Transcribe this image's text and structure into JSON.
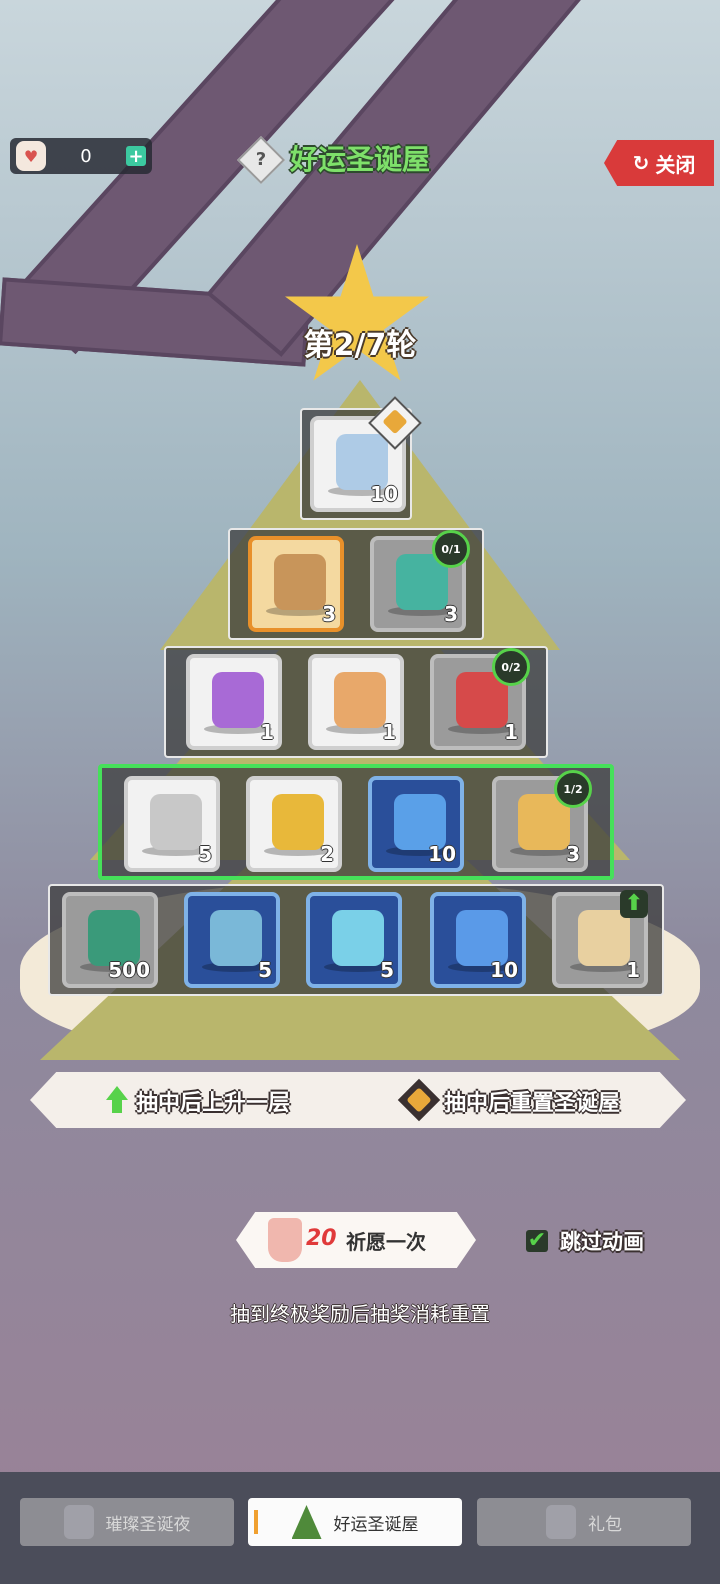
{
  "header": {
    "currency_value": "0",
    "currency_plus": "+",
    "help_symbol": "?",
    "title": "好运圣诞屋",
    "close_label": "关闭"
  },
  "round_label": "第2/7轮",
  "rows": [
    {
      "items": [
        {
          "count": "10",
          "style": "white",
          "art": "crystal-shard-icon",
          "art_color": "#aecbe6",
          "badge": "crown"
        }
      ]
    },
    {
      "items": [
        {
          "count": "3",
          "style": "gold",
          "art": "treasure-chest-icon",
          "art_color": "#c8955a"
        },
        {
          "count": "3",
          "style": "gray",
          "art": "clover-emblem-icon",
          "art_color": "#46b3a0",
          "progress": "0/1"
        }
      ]
    },
    {
      "items": [
        {
          "count": "1",
          "style": "white",
          "art": "scroll-icon",
          "art_color": "#a86ad6"
        },
        {
          "count": "1",
          "style": "white",
          "art": "book-icon",
          "art_color": "#e8a86a"
        },
        {
          "count": "1",
          "style": "gray",
          "art": "snow-globe-icon",
          "art_color": "#d64a4a",
          "progress": "0/2"
        }
      ]
    },
    {
      "active": true,
      "items": [
        {
          "count": "5",
          "style": "white",
          "art": "stone-icon",
          "art_color": "#c8c8c8"
        },
        {
          "count": "2",
          "style": "white",
          "art": "key-icon",
          "art_color": "#e8b83a"
        },
        {
          "count": "10",
          "style": "blue",
          "art": "map-icon",
          "art_color": "#5aa0e8"
        },
        {
          "count": "3",
          "style": "gray",
          "art": "gold-blocks-icon",
          "art_color": "#e8b85a",
          "progress": "1/2"
        }
      ]
    },
    {
      "items": [
        {
          "count": "500",
          "style": "gray",
          "art": "green-gem-icon",
          "art_color": "#3a9a7a"
        },
        {
          "count": "5",
          "style": "blue",
          "art": "mech-part-icon",
          "art_color": "#7ab8d8"
        },
        {
          "count": "5",
          "style": "blue",
          "art": "ice-crystal-icon",
          "art_color": "#7ad0e8"
        },
        {
          "count": "10",
          "style": "blue",
          "art": "blue-cube-icon",
          "art_color": "#5a9ae8"
        },
        {
          "count": "1",
          "style": "gray",
          "art": "parchment-scroll-icon",
          "art_color": "#e8d0a0",
          "badge": "up"
        }
      ]
    }
  ],
  "legend": {
    "up_label": "抽中后上升一层",
    "reset_label": "抽中后重置圣诞屋"
  },
  "draw": {
    "cost": "20",
    "label": "祈愿一次"
  },
  "skip": {
    "check": "✔",
    "label": "跳过动画"
  },
  "note": "抽到终极奖励后抽奖消耗重置",
  "tabs": [
    {
      "label": "璀璨圣诞夜",
      "selected": false
    },
    {
      "label": "好运圣诞屋",
      "selected": true
    },
    {
      "label": "礼包",
      "selected": false
    }
  ],
  "colors": {
    "active_row": "#46e05a",
    "title": "#7ee06a",
    "close": "#d93a3a"
  }
}
